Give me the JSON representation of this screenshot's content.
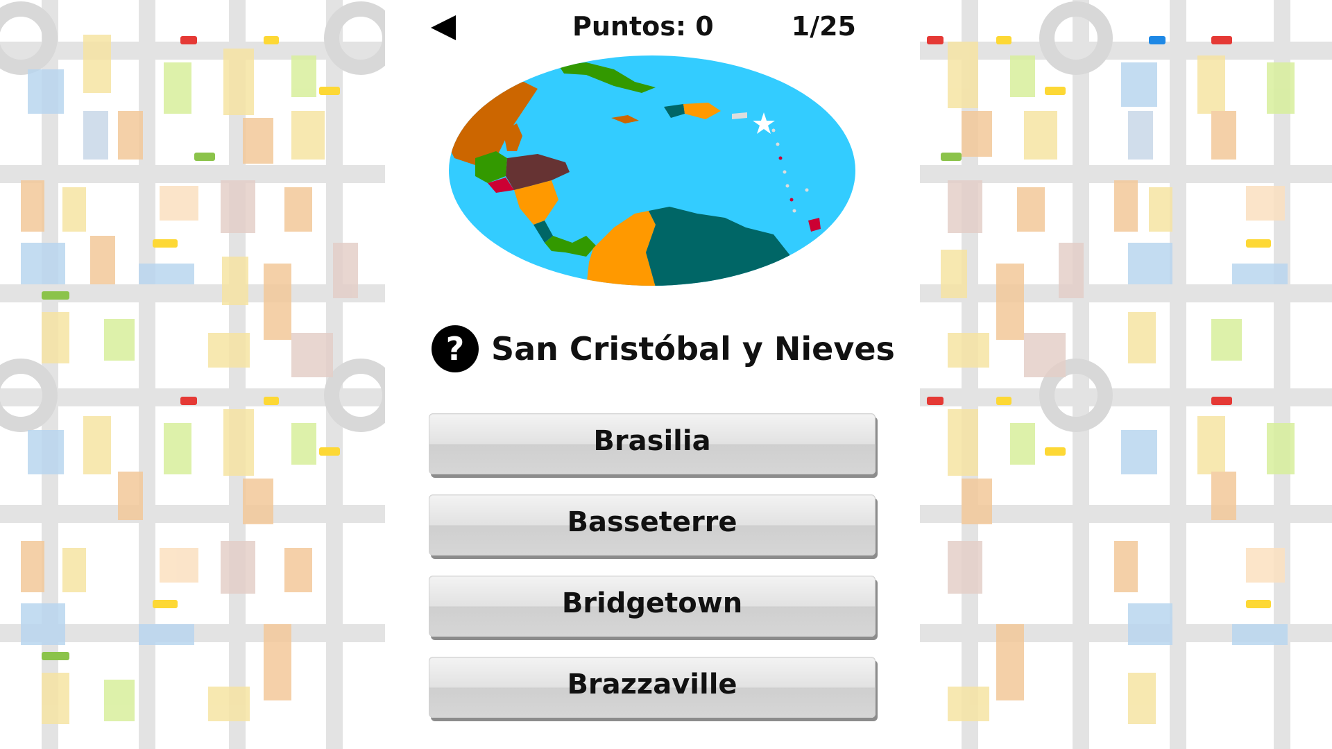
{
  "header": {
    "back_icon": "back-triangle-icon",
    "score": "Puntos: 0",
    "progress": "1/25"
  },
  "map": {
    "region": "Caribbean and Central America",
    "ocean_color": "#33ccff",
    "highlight_marker": "star-icon"
  },
  "question": {
    "icon": "question-circle-icon",
    "text": "San Cristóbal y Nieves"
  },
  "answers": [
    {
      "label": "Brasilia"
    },
    {
      "label": "Basseterre"
    },
    {
      "label": "Bridgetown"
    },
    {
      "label": "Brazzaville"
    }
  ],
  "colors": {
    "button_top": "#f3f3f3",
    "button_bottom": "#d6d6d6",
    "button_shadow": "#8c8c8c",
    "text": "#111111"
  }
}
